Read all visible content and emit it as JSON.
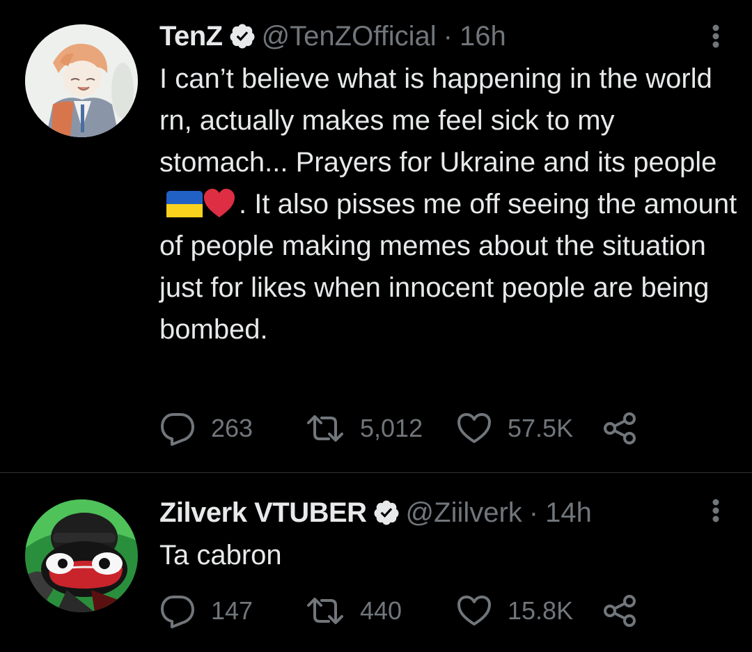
{
  "tweets": [
    {
      "name": "TenZ",
      "handle": "@TenZOfficial",
      "separator": "·",
      "time": "16h",
      "text_before_emoji": "I can’t believe what is happening in the world rn, actually makes me feel sick to my stomach... Prayers for Ukraine and its people",
      "text_after_emoji": ". It also pisses me off seeing the amount of people making memes about the situation just for likes when innocent people are being bombed.",
      "replies": "263",
      "retweets": "5,012",
      "likes": "57.5K"
    },
    {
      "name": "Zilverk VTUBER",
      "handle": "@Ziilverk",
      "separator": "·",
      "time": "14h",
      "text": "Ta cabron",
      "replies": "147",
      "retweets": "440",
      "likes": "15.8K"
    }
  ],
  "icons": {
    "verified": "verified-badge-icon",
    "more": "more-vertical-icon",
    "reply": "reply-icon",
    "retweet": "retweet-icon",
    "like": "heart-icon",
    "share": "share-icon",
    "flag": "ukraine-flag-emoji",
    "heart_emoji": "red-heart-emoji"
  },
  "colors": {
    "background": "#000000",
    "text": "#e7e9ea",
    "secondary": "#71767b",
    "divider": "#2f3336",
    "flag_blue": "#2160c4",
    "flag_yellow": "#f8d21c",
    "heart_red": "#dd2e44"
  }
}
